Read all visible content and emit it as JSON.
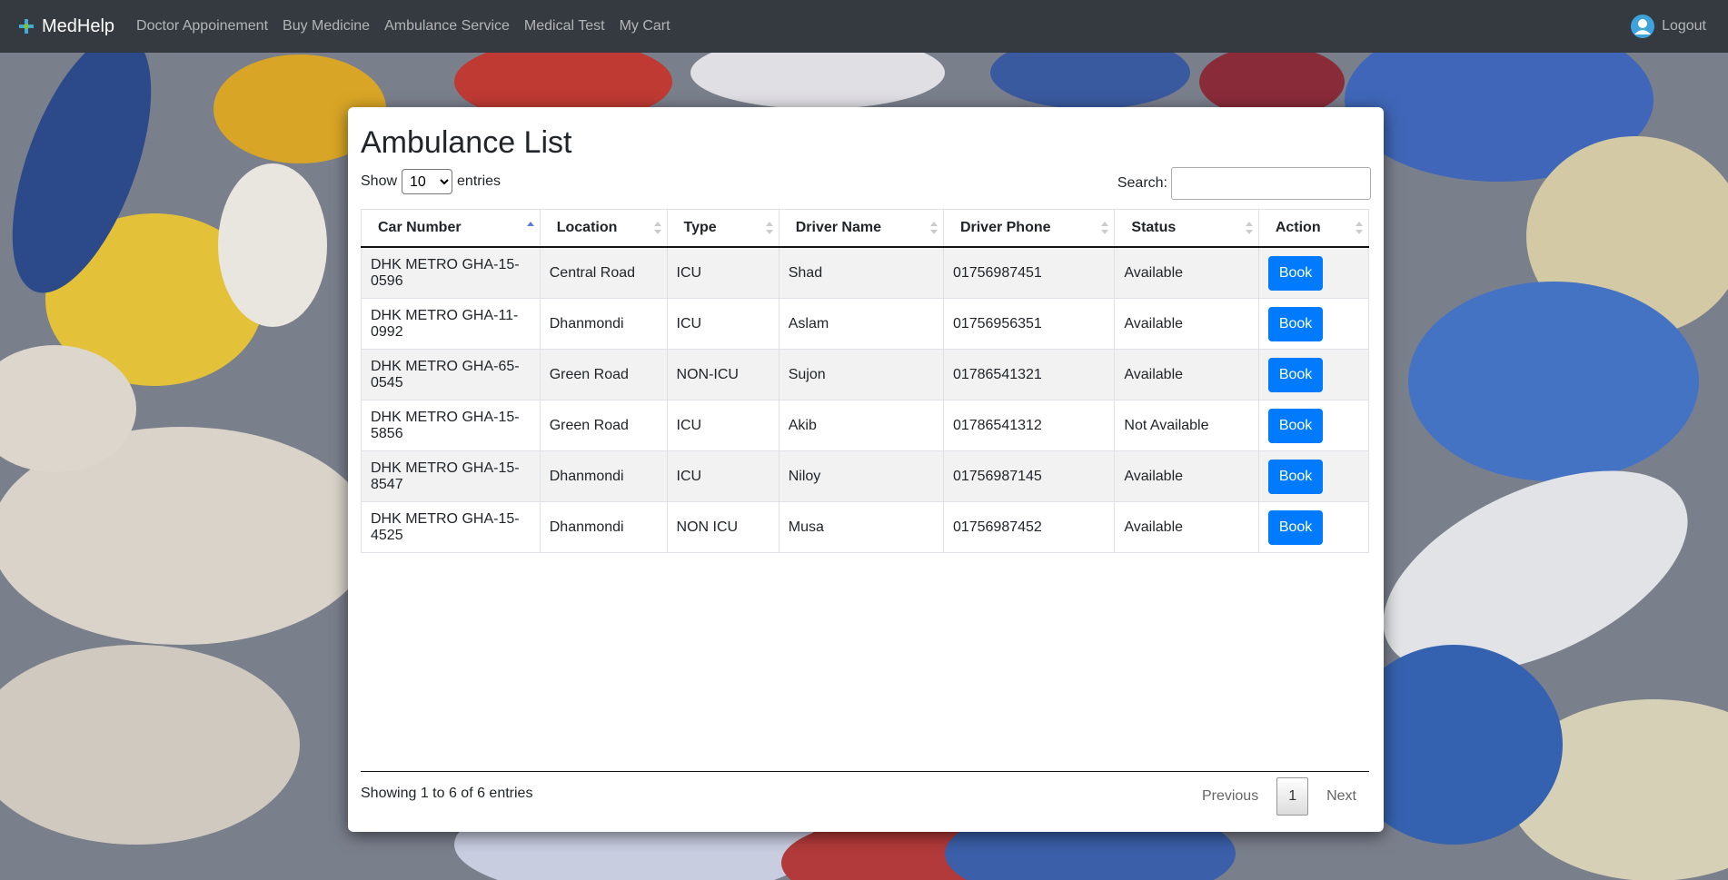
{
  "nav": {
    "brand": "MedHelp",
    "links": [
      "Doctor Appoinement",
      "Buy Medicine",
      "Ambulance Service",
      "Medical Test",
      "My Cart"
    ],
    "logout": "Logout"
  },
  "page": {
    "title": "Ambulance List",
    "show_label": "Show",
    "entries_label": "entries",
    "length_value": "10",
    "search_label": "Search:",
    "search_value": "",
    "info": "Showing 1 to 6 of 6 entries",
    "prev": "Previous",
    "page_num": "1",
    "next": "Next"
  },
  "table": {
    "headers": [
      "Car Number",
      "Location",
      "Type",
      "Driver Name",
      "Driver Phone",
      "Status",
      "Action"
    ],
    "rows": [
      {
        "car": "DHK METRO GHA-15-0596",
        "location": "Central Road",
        "type": "ICU",
        "driver": "Shad",
        "phone": "01756987451",
        "status": "Available",
        "action": "Book"
      },
      {
        "car": "DHK METRO GHA-11-0992",
        "location": "Dhanmondi",
        "type": "ICU",
        "driver": "Aslam",
        "phone": "01756956351",
        "status": "Available",
        "action": "Book"
      },
      {
        "car": "DHK METRO GHA-65-0545",
        "location": "Green Road",
        "type": "NON-ICU",
        "driver": "Sujon",
        "phone": "01786541321",
        "status": "Available",
        "action": "Book"
      },
      {
        "car": "DHK METRO GHA-15-5856",
        "location": "Green Road",
        "type": "ICU",
        "driver": "Akib",
        "phone": "01786541312",
        "status": "Not Available",
        "action": "Book"
      },
      {
        "car": "DHK METRO GHA-15-8547",
        "location": "Dhanmondi",
        "type": "ICU",
        "driver": "Niloy",
        "phone": "01756987145",
        "status": "Available",
        "action": "Book"
      },
      {
        "car": "DHK METRO GHA-15-4525",
        "location": "Dhanmondi",
        "type": "NON ICU",
        "driver": "Musa",
        "phone": "01756987452",
        "status": "Available",
        "action": "Book"
      }
    ]
  },
  "colors": {
    "navbar": "#343a40",
    "primary_button": "#007bff",
    "striped_row": "#f2f2f2"
  }
}
